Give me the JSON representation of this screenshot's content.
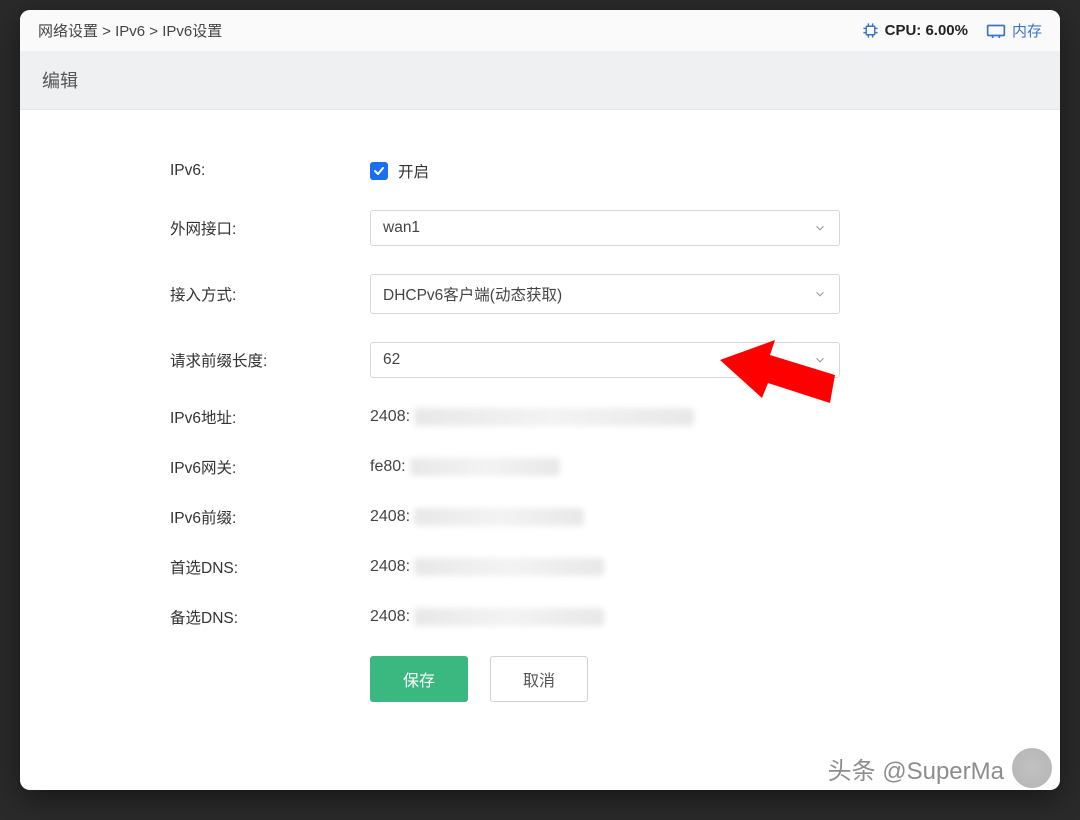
{
  "breadcrumb": {
    "text": "网络设置 > IPv6 > IPv6设置"
  },
  "status_bar": {
    "cpu_label": "CPU: 6.00%",
    "mem_label": "内存"
  },
  "section": {
    "title": "编辑"
  },
  "form": {
    "ipv6": {
      "label": "IPv6:",
      "checkbox_label": "开启",
      "checked": true
    },
    "wan_if": {
      "label": "外网接口:",
      "value": "wan1"
    },
    "access_mode": {
      "label": "接入方式:",
      "value": "DHCPv6客户端(动态获取)"
    },
    "prefix_len": {
      "label": "请求前缀长度:",
      "value": "62"
    },
    "ipv6_addr": {
      "label": "IPv6地址:",
      "prefix": "2408:"
    },
    "ipv6_gw": {
      "label": "IPv6网关:",
      "prefix": "fe80:"
    },
    "ipv6_prefix": {
      "label": "IPv6前缀:",
      "prefix": "2408:"
    },
    "dns1": {
      "label": "首选DNS:",
      "prefix": "2408:"
    },
    "dns2": {
      "label": "备选DNS:",
      "prefix": "2408:"
    }
  },
  "buttons": {
    "save": "保存",
    "cancel": "取消"
  },
  "watermark": {
    "text": "头条 @SuperMa"
  }
}
